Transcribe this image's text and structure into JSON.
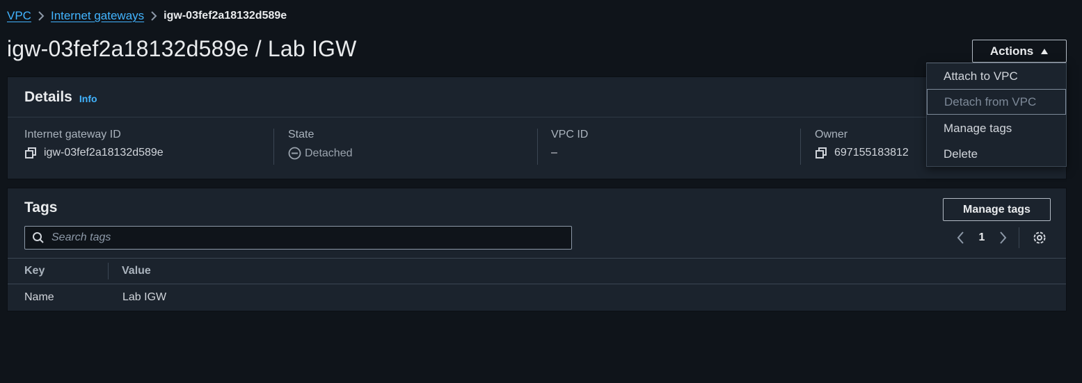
{
  "breadcrumb": {
    "items": [
      {
        "label": "VPC"
      },
      {
        "label": "Internet gateways"
      }
    ],
    "current": "igw-03fef2a18132d589e"
  },
  "page": {
    "title": "igw-03fef2a18132d589e / Lab IGW"
  },
  "actions": {
    "label": "Actions",
    "menu": [
      {
        "label": "Attach to VPC",
        "disabled": false
      },
      {
        "label": "Detach from VPC",
        "disabled": true
      },
      {
        "label": "Manage tags",
        "disabled": false
      },
      {
        "label": "Delete",
        "disabled": false
      }
    ]
  },
  "details": {
    "title": "Details",
    "info": "Info",
    "fields": [
      {
        "label": "Internet gateway ID",
        "value": "igw-03fef2a18132d589e"
      },
      {
        "label": "State",
        "value": "Detached"
      },
      {
        "label": "VPC ID",
        "value": "–"
      },
      {
        "label": "Owner",
        "value": "697155183812"
      }
    ]
  },
  "tags": {
    "title": "Tags",
    "manage_label": "Manage tags",
    "search_placeholder": "Search tags",
    "page": "1",
    "columns": [
      "Key",
      "Value"
    ],
    "rows": [
      {
        "key": "Name",
        "value": "Lab IGW"
      }
    ]
  },
  "colors": {
    "background": "#0f141a",
    "panel": "#1b232d",
    "link": "#42b4ff"
  }
}
